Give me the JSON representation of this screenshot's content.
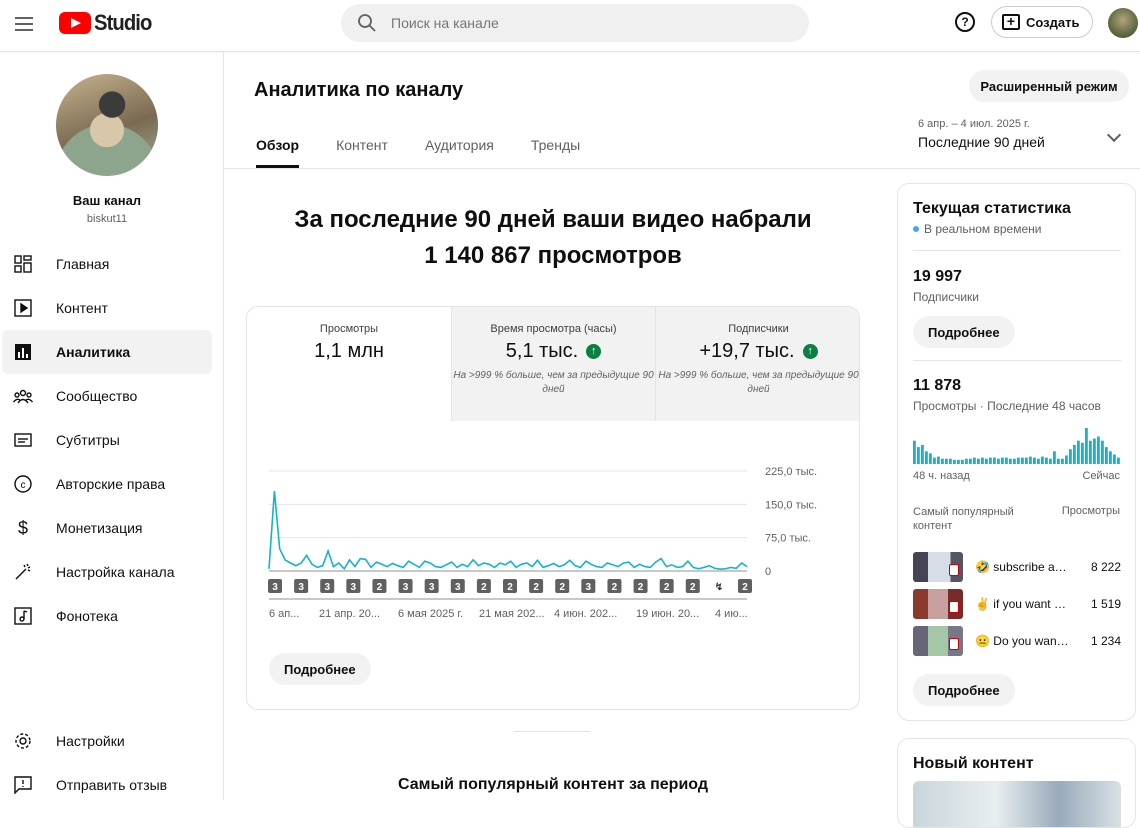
{
  "topbar": {
    "logo_text": "Studio",
    "search_placeholder": "Поиск на канале",
    "help_label": "?",
    "create_label": "Создать"
  },
  "sidebar": {
    "channel_title": "Ваш канал",
    "channel_handle": "biskut11",
    "items": [
      {
        "label": "Главная",
        "icon": "dashboard-icon"
      },
      {
        "label": "Контент",
        "icon": "content-icon"
      },
      {
        "label": "Аналитика",
        "icon": "analytics-icon",
        "active": true
      },
      {
        "label": "Сообщество",
        "icon": "community-icon"
      },
      {
        "label": "Субтитры",
        "icon": "subtitles-icon"
      },
      {
        "label": "Авторские права",
        "icon": "copyright-icon"
      },
      {
        "label": "Монетизация",
        "icon": "monetization-icon"
      },
      {
        "label": "Настройка канала",
        "icon": "customization-icon"
      },
      {
        "label": "Фонотека",
        "icon": "audio-library-icon"
      }
    ],
    "bottom": [
      {
        "label": "Настройки",
        "icon": "settings-icon"
      },
      {
        "label": "Отправить отзыв",
        "icon": "feedback-icon"
      }
    ]
  },
  "main": {
    "title": "Аналитика по каналу",
    "advanced_button": "Расширенный режим",
    "tabs": [
      "Обзор",
      "Контент",
      "Аудитория",
      "Тренды"
    ],
    "active_tab": "Обзор",
    "date_range_small": "6 апр. – 4 июл. 2025 г.",
    "date_range": "Последние 90 дней",
    "headline_line1": "За последние 90 дней ваши видео набрали",
    "headline_line2": "1 140 867 просмотров",
    "kpis": [
      {
        "label": "Просмотры",
        "value": "1,1 млн",
        "note": ""
      },
      {
        "label": "Время просмотра (часы)",
        "value": "5,1 тыс.",
        "note": "На >999 % больше, чем за предыдущие 90 дней"
      },
      {
        "label": "Подписчики",
        "value": "+19,7 тыс.",
        "note": "На >999 % больше, чем за предыдущие 90 дней"
      }
    ],
    "more_button": "Подробнее",
    "popular_title": "Самый популярный контент за период"
  },
  "chart_data": {
    "type": "line",
    "y_ticks": [
      "225,0 тыс.",
      "150,0 тыс.",
      "75,0 тыс.",
      "0"
    ],
    "ylim": [
      0,
      225000
    ],
    "x_ticks": [
      "6 ап...",
      "21 апр. 20...",
      "6 мая 2025 г.",
      "21 мая 202...",
      "4 июн. 202...",
      "19 июн. 20...",
      "4 ию... "
    ],
    "color": "#12b5cb",
    "values": [
      5000,
      180000,
      50000,
      25000,
      18000,
      12000,
      18000,
      35000,
      15000,
      8000,
      12000,
      45000,
      10000,
      18000,
      5000,
      25000,
      10000,
      28000,
      26000,
      8000,
      20000,
      15000,
      10000,
      17000,
      12000,
      8000,
      22000,
      15000,
      8000,
      22000,
      18000,
      10000,
      8000,
      14000,
      20000,
      8000,
      15000,
      10000,
      25000,
      12000,
      18000,
      15000,
      8000,
      18000,
      14000,
      22000,
      8000,
      15000,
      18000,
      10000,
      24000,
      8000,
      12000,
      17000,
      10000,
      14000,
      24000,
      12000,
      8000,
      22000,
      15000,
      10000,
      8000,
      18000,
      14000,
      10000,
      18000,
      20000,
      8000,
      15000,
      10000,
      8000,
      20000,
      28000,
      10000,
      14000,
      8000,
      10000,
      22000,
      8000,
      5000,
      8000,
      12000,
      6000,
      4000,
      5000,
      8000,
      6000,
      18000,
      10000
    ],
    "markers": [
      "3",
      "3",
      "3",
      "3",
      "2",
      "3",
      "3",
      "3",
      "2",
      "2",
      "2",
      "2",
      "3",
      "2",
      "2",
      "2",
      "2",
      "↯",
      "2"
    ]
  },
  "realtime": {
    "title": "Текущая статистика",
    "realtime_label": "В реальном времени",
    "subscribers_value": "19 997",
    "subscribers_label": "Подписчики",
    "more_button": "Подробнее",
    "views_value": "11 878",
    "views_label": "Просмотры · Последние 48 часов",
    "start_label": "48 ч. назад",
    "end_label": "Сейчас",
    "top_content_label": "Самый популярный контент",
    "views_col_label": "Просмотры",
    "bars": [
      22,
      16,
      18,
      12,
      10,
      6,
      7,
      5,
      5,
      5,
      4,
      4,
      4,
      5,
      5,
      6,
      5,
      6,
      5,
      6,
      6,
      5,
      6,
      6,
      5,
      5,
      6,
      6,
      6,
      7,
      6,
      5,
      7,
      6,
      5,
      12,
      5,
      5,
      8,
      14,
      18,
      22,
      20,
      34,
      22,
      24,
      26,
      22,
      16,
      12,
      9,
      6
    ],
    "top_videos": [
      {
        "title": "🤣 subscribe and like ...",
        "views": "8 222"
      },
      {
        "title": "✌️ if you want to ...",
        "views": "1 519"
      },
      {
        "title": "😐 Do you want ...",
        "views": "1 234"
      }
    ],
    "more_button2": "Подробнее",
    "new_content_title": "Новый контент"
  }
}
